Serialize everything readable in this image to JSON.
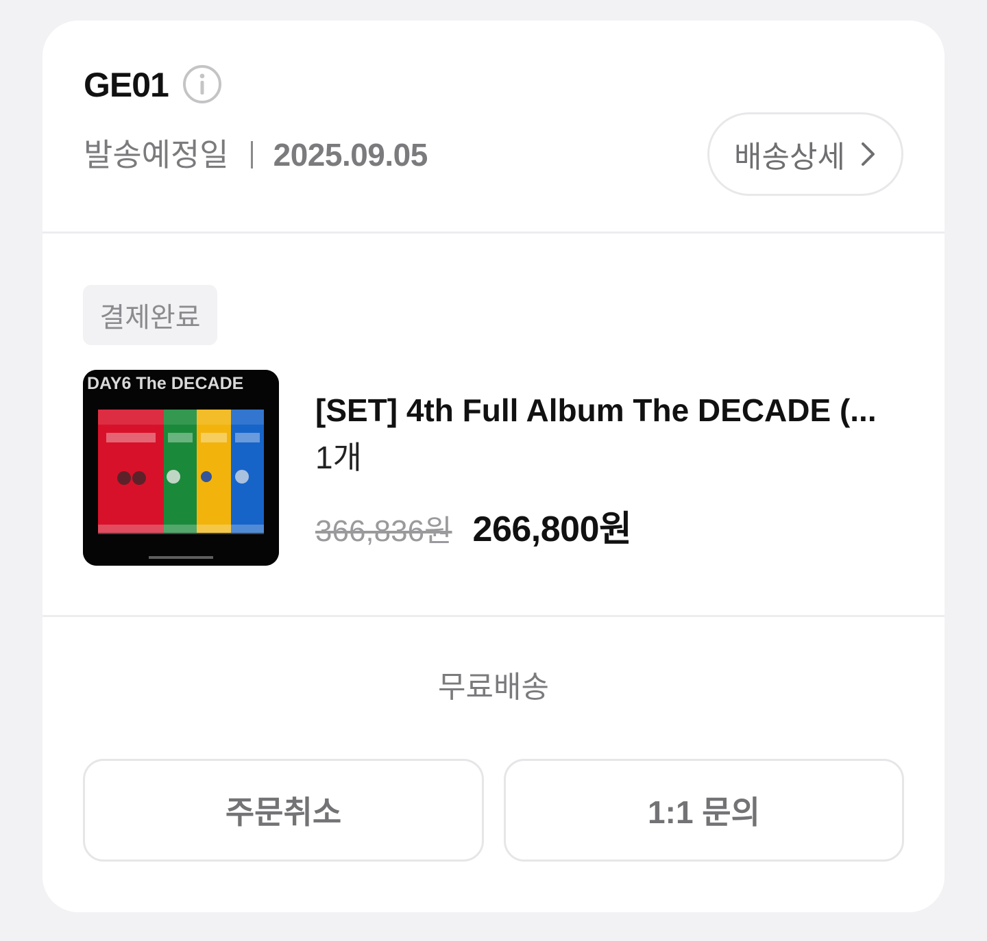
{
  "order": {
    "id": "GE01",
    "ship_label": "발송예정일",
    "ship_date": "2025.09.05",
    "detail_button": "배송상세"
  },
  "item": {
    "status": "결제완료",
    "thumbnail_text": "DAY6 The DECADE",
    "title": "[SET] 4th Full Album The DECADE (...",
    "quantity": "1개",
    "original_price": "366,836원",
    "sale_price": "266,800원"
  },
  "shipping": {
    "fee_label": "무료배송"
  },
  "actions": {
    "cancel": "주문취소",
    "inquiry": "1:1 문의"
  },
  "icons": {
    "info": "info-icon",
    "chevron": "chevron-right-icon"
  },
  "colors": {
    "page_background": "#f2f2f5",
    "card_background": "#ffffff",
    "primary_text": "#111111",
    "secondary_text": "#7b7b7e",
    "badge_background": "#f2f2f4"
  }
}
